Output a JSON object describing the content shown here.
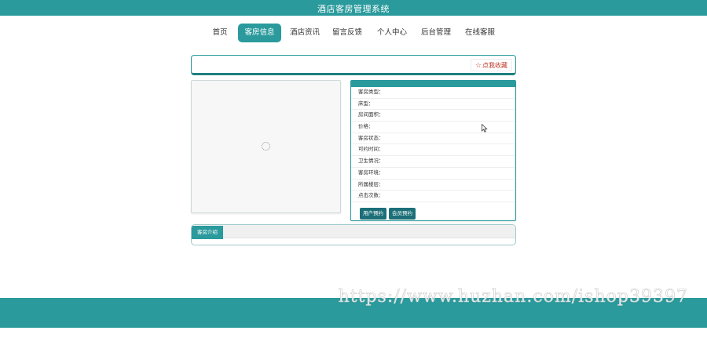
{
  "header": {
    "title": "酒店客房管理系统"
  },
  "nav": {
    "items": [
      {
        "label": "首页"
      },
      {
        "label": "客房信息"
      },
      {
        "label": "酒店资讯"
      },
      {
        "label": "留言反馈"
      },
      {
        "label": "个人中心"
      },
      {
        "label": "后台管理"
      },
      {
        "label": "在线客服"
      }
    ],
    "active_index": 1
  },
  "favorite": {
    "label": "点我收藏"
  },
  "details": {
    "rows": [
      {
        "label": "客房类型："
      },
      {
        "label": "床型："
      },
      {
        "label": "房间面积："
      },
      {
        "label": "价格："
      },
      {
        "label": "客房状态："
      },
      {
        "label": "可约时间："
      },
      {
        "label": "卫生情况："
      },
      {
        "label": "客房环境："
      },
      {
        "label": "所属楼层："
      },
      {
        "label": "点击次数："
      }
    ],
    "buttons": [
      {
        "label": "用户预约"
      },
      {
        "label": "会员预约"
      }
    ]
  },
  "intro": {
    "tab_label": "客房介绍"
  },
  "watermark": {
    "text": "https://www.huzhan.com/ishop39397"
  },
  "colors": {
    "primary": "#2a9a9c",
    "button_dark": "#1c6f78",
    "favorite": "#c0392b"
  }
}
